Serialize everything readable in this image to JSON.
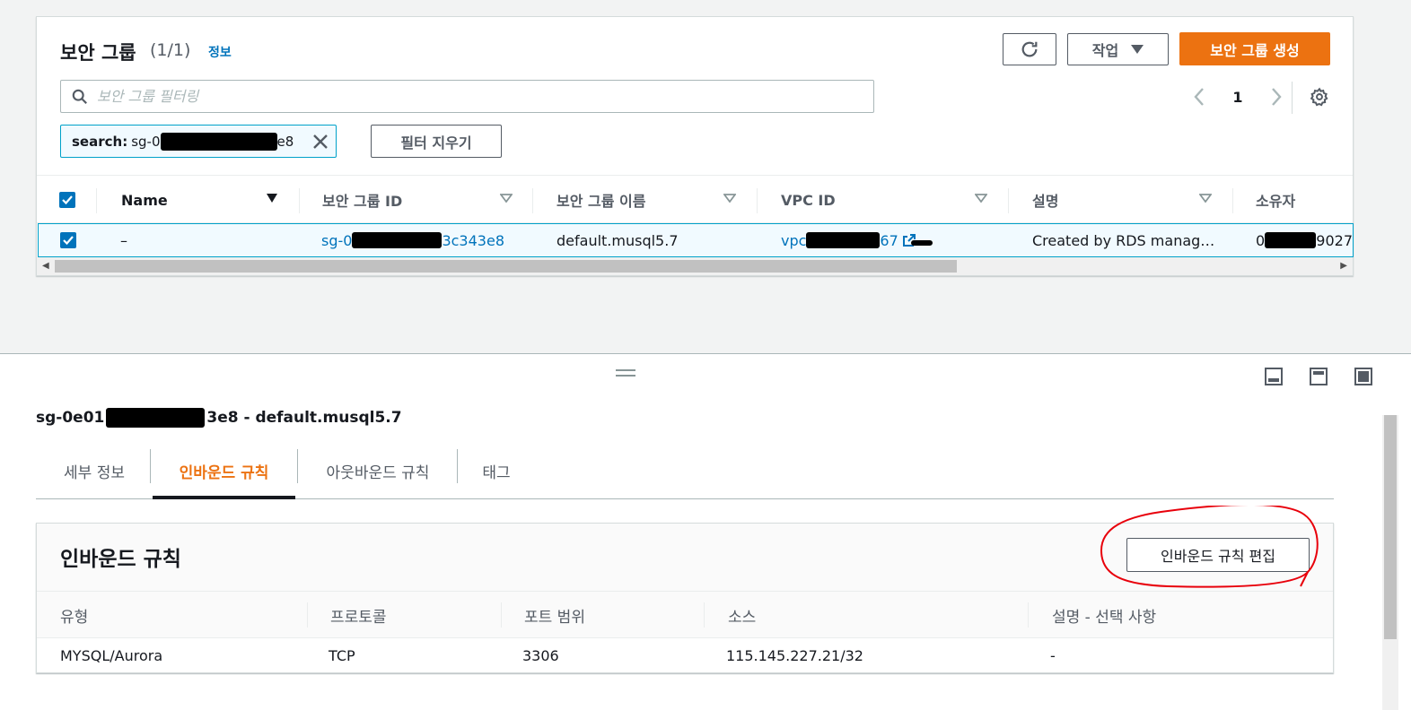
{
  "security_groups": {
    "title": "보안 그룹",
    "count": "(1/1)",
    "info": "정보",
    "actions_label": "작업",
    "create_label": "보안 그룹 생성",
    "search_placeholder": "보안 그룹 필터링",
    "page": "1",
    "filter_token": {
      "key": "search:",
      "value_start": "sg-0",
      "value_end": "e8"
    },
    "clear_filter_label": "필터 지우기",
    "columns": [
      "Name",
      "보안 그룹 ID",
      "보안 그룹 이름",
      "VPC ID",
      "설명",
      "소유자"
    ],
    "row": {
      "name": "–",
      "sg_id_start": "sg-0",
      "sg_id_end": "3c343e8",
      "sg_name": "default.musql5.7",
      "vpc_id_start": "vpc",
      "vpc_id_end": "67",
      "description": "Created by RDS manag…",
      "owner_start": "0",
      "owner_end": "9027"
    }
  },
  "detail": {
    "title_start": "sg-0e01",
    "title_end": "3e8 - default.musql5.7",
    "tabs": [
      "세부 정보",
      "인바운드 규칙",
      "아웃바운드 규칙",
      "태그"
    ],
    "active_tab": "인바운드 규칙"
  },
  "inbound": {
    "title": "인바운드 규칙",
    "edit_label": "인바운드 규칙 편집",
    "columns": [
      "유형",
      "프로토콜",
      "포트 범위",
      "소스",
      "설명 - 선택 사항"
    ],
    "rows": [
      {
        "type": "MYSQL/Aurora",
        "protocol": "TCP",
        "port": "3306",
        "source": "115.145.227.21/32",
        "description": "-"
      }
    ]
  },
  "colors": {
    "accent": "#ec7211",
    "link": "#0073bb",
    "selected_bg": "#f1faff",
    "selected_border": "#00a1c9",
    "annotation": "#e8000b"
  }
}
